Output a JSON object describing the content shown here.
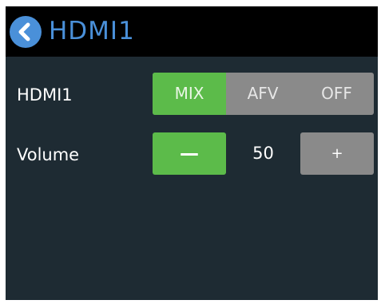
{
  "header": {
    "title": "HDMI1",
    "back_icon": "chevron-left-icon"
  },
  "audio_mode": {
    "label": "HDMI1",
    "options": [
      "MIX",
      "AFV",
      "OFF"
    ],
    "selected": "MIX"
  },
  "volume": {
    "label": "Volume",
    "value": "50",
    "minus_label": "—",
    "plus_label": "+"
  },
  "colors": {
    "background": "#1e2b33",
    "header_background": "#000000",
    "accent_blue": "#4a90d9",
    "active_green": "#5cbb4a",
    "inactive_gray": "#8a8a8a"
  }
}
